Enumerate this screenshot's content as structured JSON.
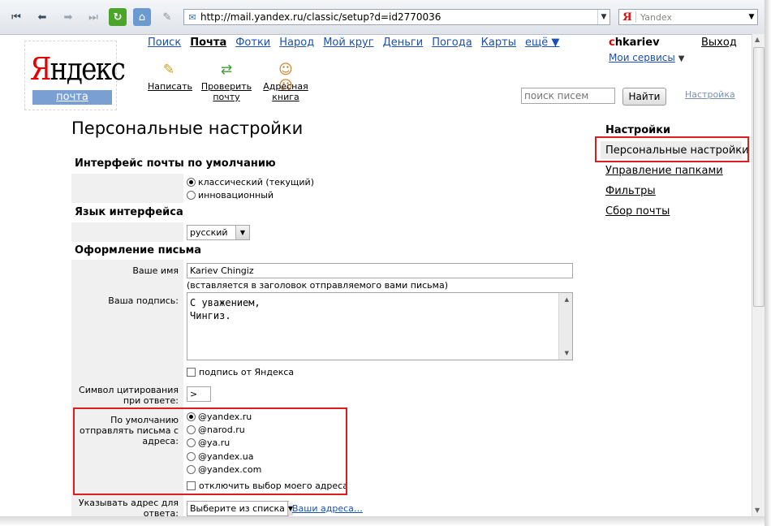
{
  "browser": {
    "url": "http://mail.yandex.ru/classic/setup?d=id2770036",
    "search_engine": "Yandex",
    "icons": [
      "first-page-icon",
      "back-arrow-icon",
      "forward-arrow-icon",
      "last-page-icon",
      "reload-icon",
      "home-icon",
      "pen-icon"
    ]
  },
  "logo": {
    "first_letter": "Я",
    "rest": "ндекс",
    "sub": "почта",
    "brand_color": "#e60000",
    "sub_bg": "#7aa0d3"
  },
  "topnav": {
    "items": [
      "Поиск",
      "Почта",
      "Фотки",
      "Народ",
      "Мой круг",
      "Деньги",
      "Погода",
      "Карты",
      "ещё ▼"
    ],
    "active": "Почта"
  },
  "quick_actions": {
    "write": "Написать",
    "check": [
      "Проверить",
      "почту"
    ],
    "addressbook": [
      "Адресная",
      "книга"
    ]
  },
  "user": {
    "first_letter": "c",
    "rest": "hkariev",
    "logout": "Выход",
    "services": "Мои сервисы",
    "services_arrow": "▼"
  },
  "search": {
    "placeholder": "поиск писем",
    "button": "Найти",
    "settings": "Настройка"
  },
  "page": {
    "title": "Персональные настройки"
  },
  "form": {
    "interface": {
      "heading": "Интерфейс почты по умолчанию",
      "options": [
        "классический (текущий)",
        "инновационный"
      ],
      "selected": 0
    },
    "language": {
      "heading": "Язык интерфейса",
      "value": "русский"
    },
    "design": {
      "heading": "Оформление письма",
      "name_label": "Ваше имя",
      "name_value": "Kariev Chingiz",
      "name_hint": "(вставляется в заголовок отправляемого вами письма)",
      "signature_label": "Ваша подпись:",
      "signature_value": "С уважением,\nЧингиз.",
      "yandex_signature": "подпись от Яндекса",
      "quote_label": [
        "Символ цитирования",
        "при ответе:"
      ],
      "quote_value": ">",
      "from_label": [
        "По умолчанию",
        "отправлять письма с",
        "адреса:"
      ],
      "from_options": [
        "@yandex.ru",
        "@narod.ru",
        "@ya.ru",
        "@yandex.ua",
        "@yandex.com"
      ],
      "from_selected": 0,
      "disable_choice": "отключить выбор моего адреса",
      "reply_label": [
        "Указывать адрес для",
        "ответа:"
      ],
      "reply_value": "Выберите из списка",
      "my_addresses": "Ваши адреса…"
    }
  },
  "sidebar": {
    "title": "Настройки",
    "items": [
      "Персональные настройки",
      "Управление папками",
      "Фильтры",
      "Сбор почты"
    ],
    "active": 0
  },
  "colors": {
    "highlight_border": "#dc1e1e",
    "link": "#1a4fb5",
    "label_bg": "#f0f0f0"
  }
}
